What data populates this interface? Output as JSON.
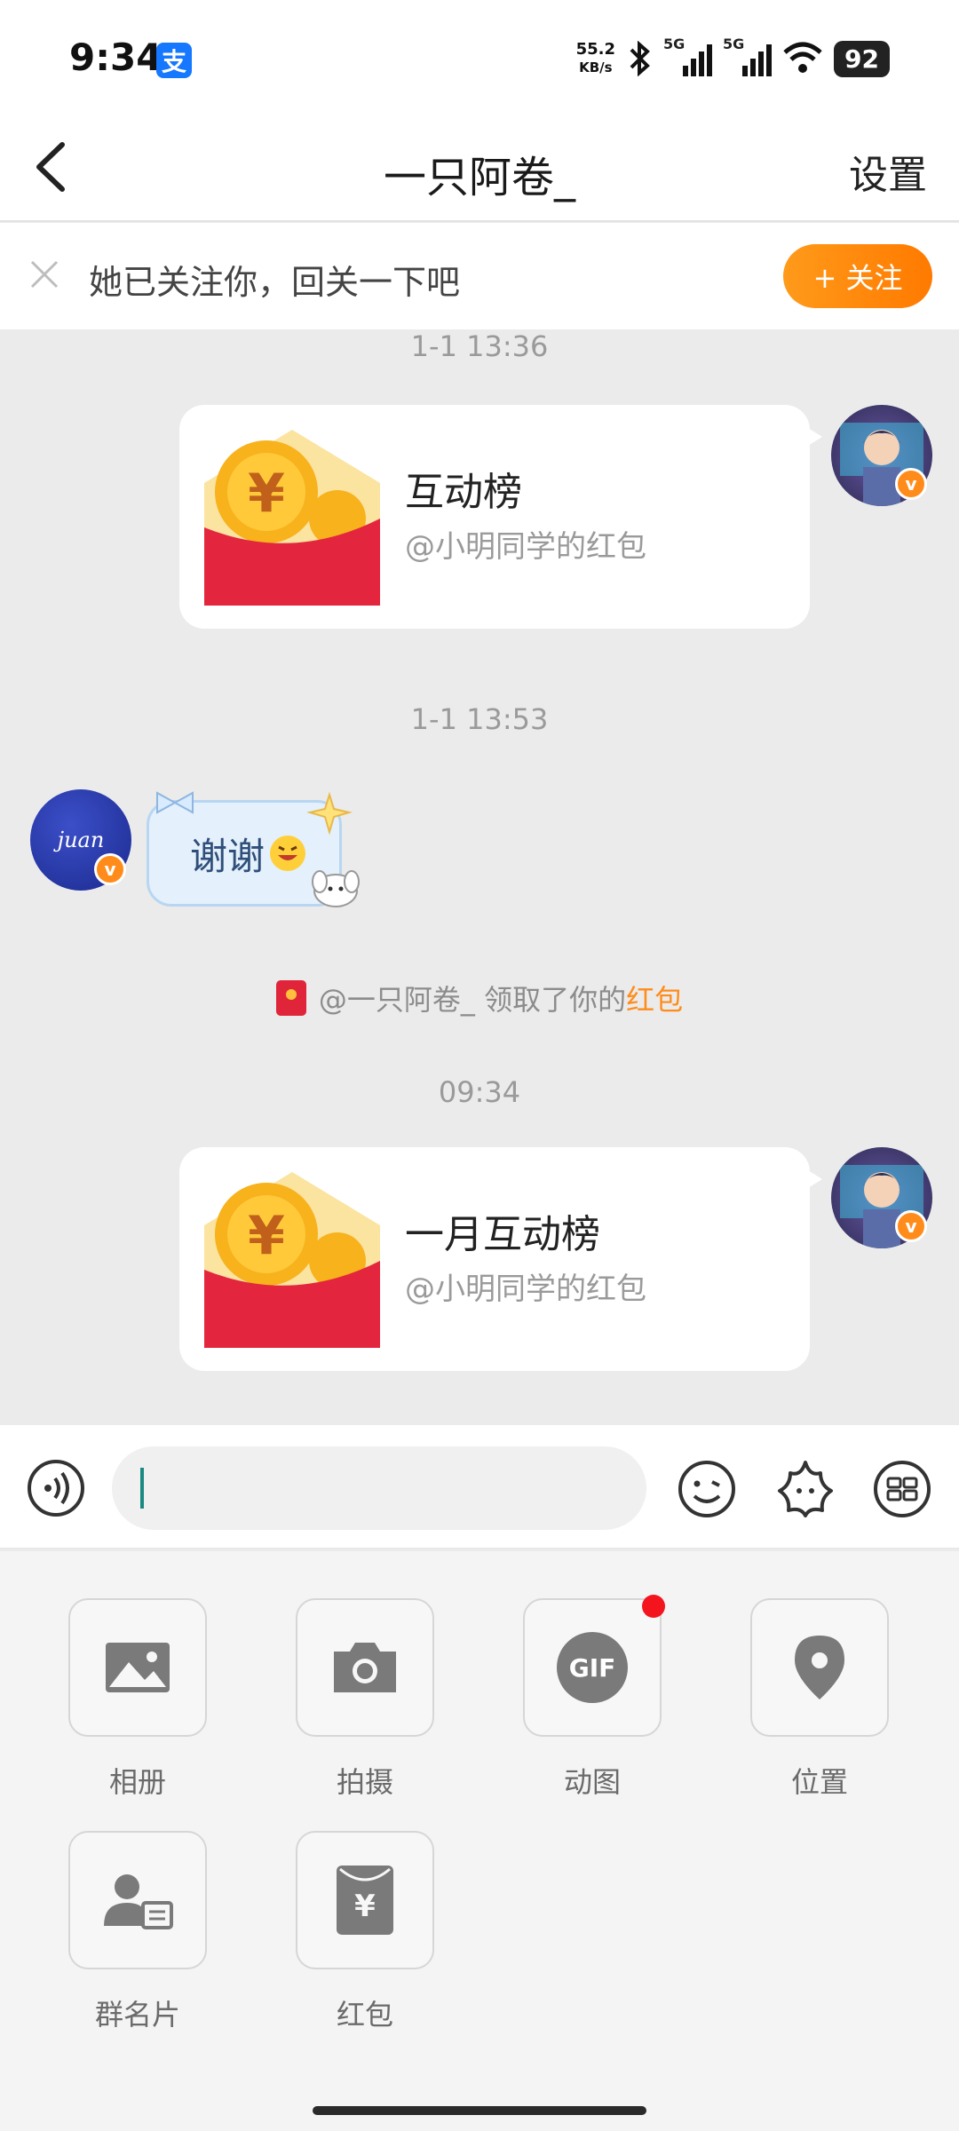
{
  "status_bar": {
    "time": "9:34",
    "net_speed_value": "55.2",
    "net_speed_unit": "KB/s",
    "sim1": "5G",
    "sim2": "5G",
    "battery": "92"
  },
  "header": {
    "title": "一只阿卷_",
    "settings_label": "设置"
  },
  "follow_banner": {
    "text": "她已关注你，回关一下吧",
    "button_label": "+ 关注"
  },
  "chat": {
    "messages": [
      {
        "timestamp": "1-1 13:36",
        "card_title": "互动榜",
        "card_subtitle": "@小明同学的红包"
      },
      {
        "timestamp": "1-1 13:53",
        "avatar_text": "juan",
        "text": "谢谢"
      },
      {
        "system_prefix": "@一只阿卷_ 领取了你的",
        "system_highlight": "红包"
      },
      {
        "timestamp": "09:34",
        "card_title": "一月互动榜",
        "card_subtitle": "@小明同学的红包"
      }
    ]
  },
  "input": {
    "value": "",
    "placeholder": ""
  },
  "tools": [
    {
      "label": "相册",
      "icon": "photo-album-icon"
    },
    {
      "label": "拍摄",
      "icon": "camera-icon"
    },
    {
      "label": "动图",
      "icon": "gif-icon",
      "badge_dot": true,
      "icon_text": "GIF"
    },
    {
      "label": "位置",
      "icon": "location-pin-icon"
    },
    {
      "label": "群名片",
      "icon": "group-card-icon"
    },
    {
      "label": "红包",
      "icon": "red-packet-icon",
      "icon_text": "¥"
    }
  ],
  "colors": {
    "accent_orange": "#ff8c1a",
    "red_packet": "#e0253b",
    "gold": "#ffc23a"
  }
}
